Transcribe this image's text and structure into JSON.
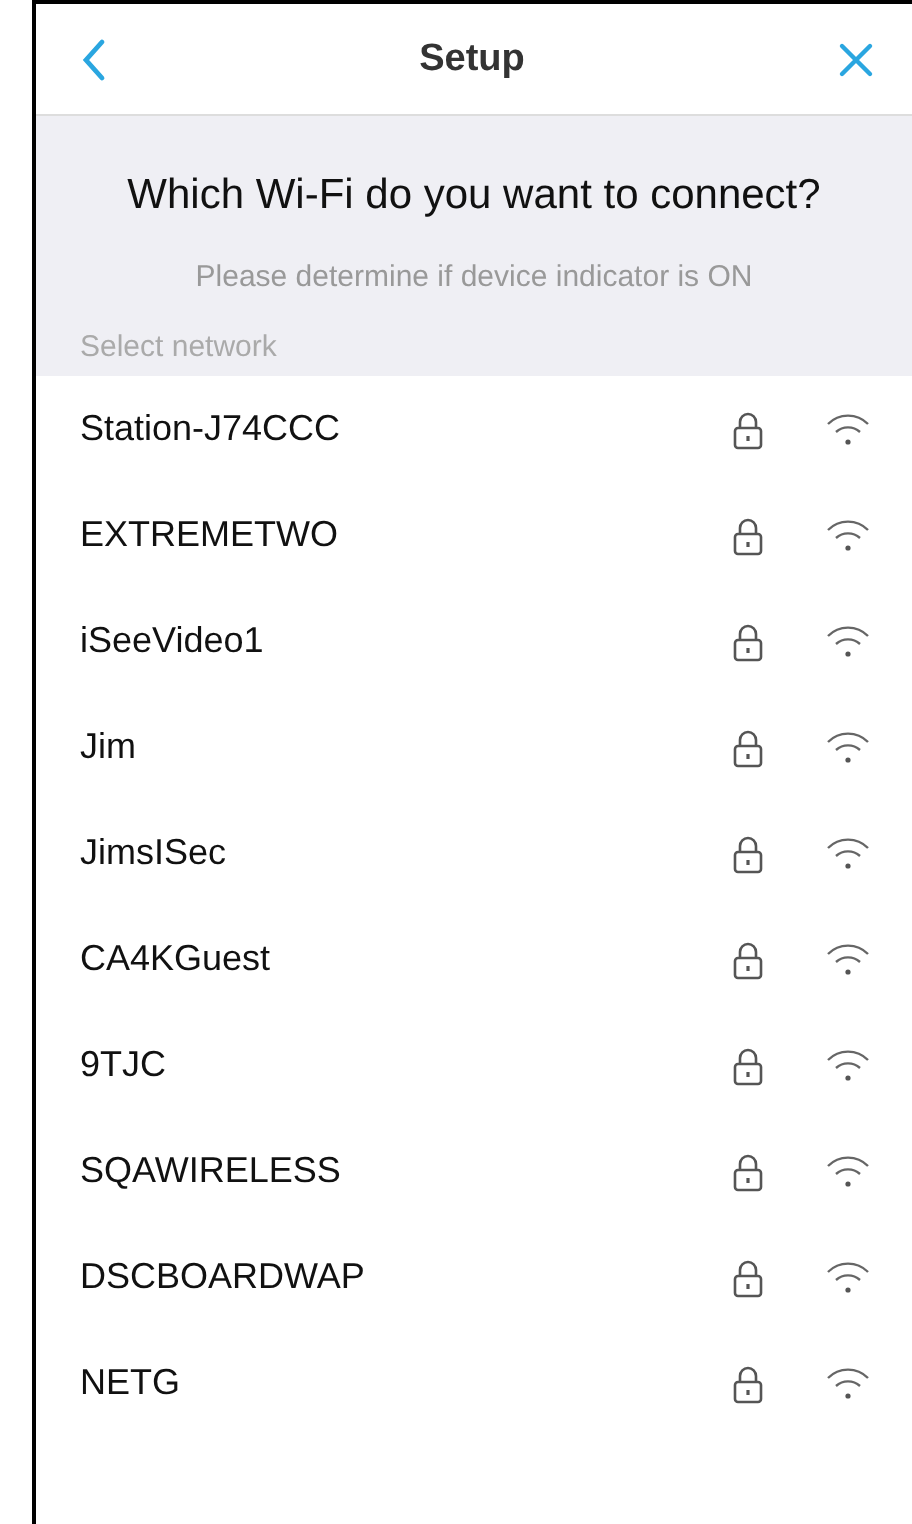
{
  "header": {
    "title": "Setup"
  },
  "heading": "Which Wi-Fi do you want to connect?",
  "hint": "Please determine if device indicator is ON",
  "section_label": "Select network",
  "networks": [
    {
      "name": "Station-J74CCC"
    },
    {
      "name": "EXTREMETWO"
    },
    {
      "name": "iSeeVideo1"
    },
    {
      "name": "Jim"
    },
    {
      "name": "JimsISec"
    },
    {
      "name": "CA4KGuest"
    },
    {
      "name": "9TJC"
    },
    {
      "name": "SQAWIRELESS"
    },
    {
      "name": "DSCBOARDWAP"
    },
    {
      "name": "NETG"
    }
  ]
}
